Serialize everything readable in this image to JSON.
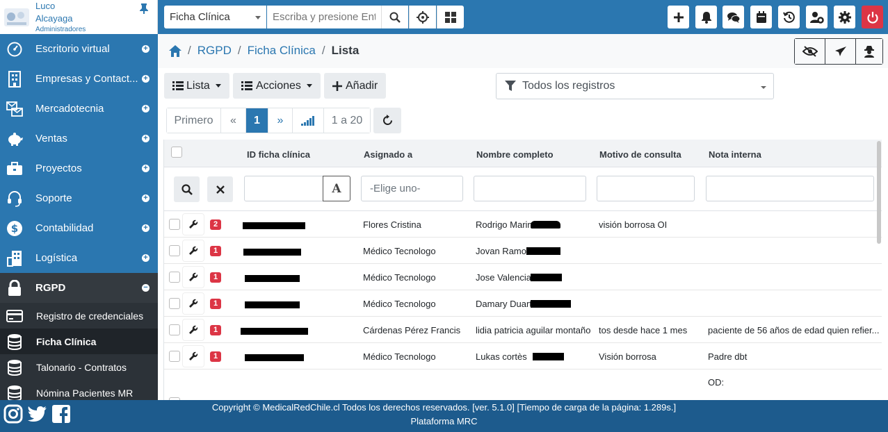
{
  "user": {
    "first_name": "Luco",
    "last_name": "Alcayaga",
    "role": "Administradores"
  },
  "sidebar": {
    "items": [
      {
        "label": "Escritorio virtual",
        "icon": "speedometer-icon"
      },
      {
        "label": "Empresas y Contact...",
        "icon": "building-icon"
      },
      {
        "label": "Mercadotecnia",
        "icon": "mail-bulk-icon"
      },
      {
        "label": "Ventas",
        "icon": "piggy-bank-icon"
      },
      {
        "label": "Proyectos",
        "icon": "briefcase-icon"
      },
      {
        "label": "Soporte",
        "icon": "headset-icon"
      },
      {
        "label": "Contabilidad",
        "icon": "dollar-icon"
      },
      {
        "label": "Logística",
        "icon": "warehouse-icon"
      },
      {
        "label": "RGPD",
        "icon": "lock-icon"
      }
    ],
    "sub_items": [
      {
        "label": "Registro de credenciales",
        "icon": "credit-card-icon"
      },
      {
        "label": "Ficha Clínica",
        "icon": "database-icon"
      },
      {
        "label": "Talonario - Contratos",
        "icon": "database-icon"
      },
      {
        "label": "Nómina Pacientes MR",
        "icon": "database-icon"
      }
    ]
  },
  "topbar": {
    "module": "Ficha Clínica",
    "search_placeholder": "Escriba y presione Enter"
  },
  "breadcrumb": {
    "items": [
      "RGPD",
      "Ficha Clínica"
    ],
    "current": "Lista"
  },
  "toolbar": {
    "list_label": "Lista",
    "actions_label": "Acciones",
    "add_label": "Añadir",
    "filter_label": "Todos los registros"
  },
  "pager": {
    "first": "Primero",
    "prev": "«",
    "page": "1",
    "next": "»",
    "range": "1 a 20"
  },
  "table": {
    "columns": [
      "ID ficha clínica",
      "Asignado a",
      "Nombre completo",
      "Motivo de consulta",
      "Nota interna"
    ],
    "assigned_placeholder": "-Elige uno-",
    "rows": [
      {
        "badge": "2",
        "asignado": "Flores Cristina",
        "nombre": "Rodrigo Marin",
        "motivo": "visión borrosa OI",
        "nota": ""
      },
      {
        "badge": "1",
        "asignado": "Médico Tecnologo",
        "nombre": "Jovan Ramos",
        "motivo": "",
        "nota": ""
      },
      {
        "badge": "1",
        "asignado": "Médico Tecnologo",
        "nombre": "Jose Valencia",
        "motivo": "",
        "nota": ""
      },
      {
        "badge": "1",
        "asignado": "Médico Tecnologo",
        "nombre": "Damary Duart",
        "motivo": "",
        "nota": ""
      },
      {
        "badge": "1",
        "asignado": "Cárdenas Pérez Francis",
        "nombre": "lidia patricia aguilar montaño",
        "motivo": "tos desde hace 1 mes",
        "nota": "paciente de 56 años de edad quien refier..."
      },
      {
        "badge": "1",
        "asignado": "Médico Tecnologo",
        "nombre": "Lukas cortès",
        "motivo": "Visión borrosa",
        "nota": "Padre dbt"
      }
    ],
    "partial_note": "OD:"
  },
  "footer": {
    "line1": "Copyright © MedicalRedChile.cl Todos los derechos reservados. [ver. 5.1.0] [Tiempo de carga de la página: 1.289s.]",
    "line2": "Plataforma MRC"
  },
  "colors": {
    "primary": "#2b77b0",
    "dark": "#343a40",
    "danger": "#dc3545",
    "footer": "#1d5b8d"
  }
}
